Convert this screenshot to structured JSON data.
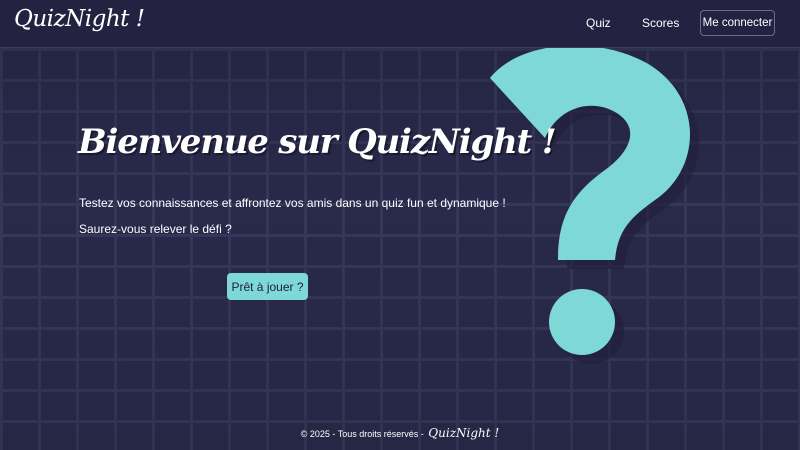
{
  "header": {
    "logo": "QuizNight !",
    "nav": {
      "quiz": "Quiz",
      "scores": "Scores"
    },
    "login_label": "Me connecter"
  },
  "hero": {
    "title": "Bienvenue sur QuizNight !",
    "line1": "Testez vos connaissances et affrontez vos amis dans un quiz fun et dynamique !",
    "line2": "Saurez-vous relever le défi ?",
    "cta_label": "Prêt à jouer ?"
  },
  "footer": {
    "text": "© 2025 - Tous droits réservés - ",
    "brand": "QuizNight !"
  },
  "colors": {
    "background": "#272746",
    "accent": "#7dd8d6",
    "text": "#ffffff"
  },
  "icons": {
    "hero_graphic": "question-mark-icon"
  }
}
